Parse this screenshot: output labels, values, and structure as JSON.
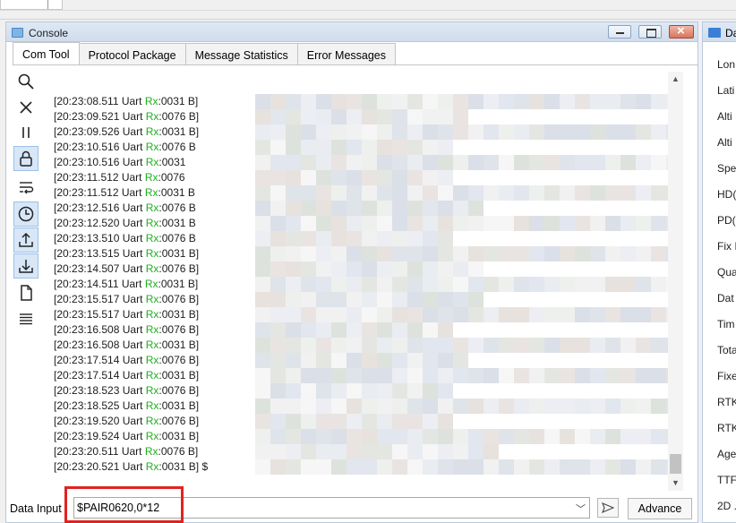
{
  "console": {
    "title": "Console",
    "tabs": [
      "Com Tool",
      "Protocol Package",
      "Message Statistics",
      "Error Messages"
    ],
    "log": [
      {
        "time": "[20:23:08.511 Uart ",
        "rx": "Rx",
        "rest": ":0031 B]"
      },
      {
        "time": "[20:23:09.521 Uart ",
        "rx": "Rx",
        "rest": ":0076 B]"
      },
      {
        "time": "[20:23:09.526 Uart ",
        "rx": "Rx",
        "rest": ":0031 B]"
      },
      {
        "time": "[20:23:10.516 Uart ",
        "rx": "Rx",
        "rest": ":0076 B"
      },
      {
        "time": "[20:23:10.516 Uart ",
        "rx": "Rx",
        "rest": ":0031"
      },
      {
        "time": "[20:23:11.512 Uart ",
        "rx": "Rx",
        "rest": ":0076"
      },
      {
        "time": "[20:23:11.512 Uart ",
        "rx": "Rx",
        "rest": ":0031 B"
      },
      {
        "time": "[20:23:12.516 Uart ",
        "rx": "Rx",
        "rest": ":0076 B"
      },
      {
        "time": "[20:23:12.520 Uart ",
        "rx": "Rx",
        "rest": ":0031 B"
      },
      {
        "time": "[20:23:13.510 Uart ",
        "rx": "Rx",
        "rest": ":0076 B"
      },
      {
        "time": "[20:23:13.515 Uart ",
        "rx": "Rx",
        "rest": ":0031 B]"
      },
      {
        "time": "[20:23:14.507 Uart ",
        "rx": "Rx",
        "rest": ":0076 B]"
      },
      {
        "time": "[20:23:14.511 Uart ",
        "rx": "Rx",
        "rest": ":0031 B]"
      },
      {
        "time": "[20:23:15.517 Uart ",
        "rx": "Rx",
        "rest": ":0076 B]"
      },
      {
        "time": "[20:23:15.517 Uart ",
        "rx": "Rx",
        "rest": ":0031 B]"
      },
      {
        "time": "[20:23:16.508 Uart ",
        "rx": "Rx",
        "rest": ":0076 B]"
      },
      {
        "time": "[20:23:16.508 Uart ",
        "rx": "Rx",
        "rest": ":0031 B]"
      },
      {
        "time": "[20:23:17.514 Uart ",
        "rx": "Rx",
        "rest": ":0076 B]"
      },
      {
        "time": "[20:23:17.514 Uart ",
        "rx": "Rx",
        "rest": ":0031 B]"
      },
      {
        "time": "[20:23:18.523 Uart ",
        "rx": "Rx",
        "rest": ":0076 B]"
      },
      {
        "time": "[20:23:18.525 Uart ",
        "rx": "Rx",
        "rest": ":0031 B]"
      },
      {
        "time": "[20:23:19.520 Uart ",
        "rx": "Rx",
        "rest": ":0076 B]"
      },
      {
        "time": "[20:23:19.524 Uart ",
        "rx": "Rx",
        "rest": ":0031 B]"
      },
      {
        "time": "[20:23:20.511 Uart ",
        "rx": "Rx",
        "rest": ":0076 B]"
      },
      {
        "time": "[20:23:20.521 Uart ",
        "rx": "Rx",
        "rest": ":0031 B] $"
      }
    ],
    "input": {
      "label": "Data Input",
      "value": "$PAIR0620,0*12"
    },
    "advance_label": "Advance",
    "tools": [
      "search-icon",
      "clear-icon",
      "pause-icon",
      "lock-icon",
      "wrap-icon",
      "clock-icon",
      "upload-icon",
      "download-icon",
      "file-icon",
      "list-icon"
    ]
  },
  "data_panel": {
    "title": "Da",
    "fields": [
      "Lon",
      "Lati",
      "Alti",
      "Alti",
      "Spe",
      "HD(",
      "PD(",
      "Fix I",
      "Qua",
      "Dat",
      "Tim",
      "Tota",
      "Fixe",
      "RTK",
      "RTK",
      "Age",
      "TTF",
      "2D ."
    ]
  },
  "colors": {
    "rx_green": "#1fae1f",
    "highlight_red": "#e0231f",
    "accent_blue": "#3a7fd5"
  }
}
